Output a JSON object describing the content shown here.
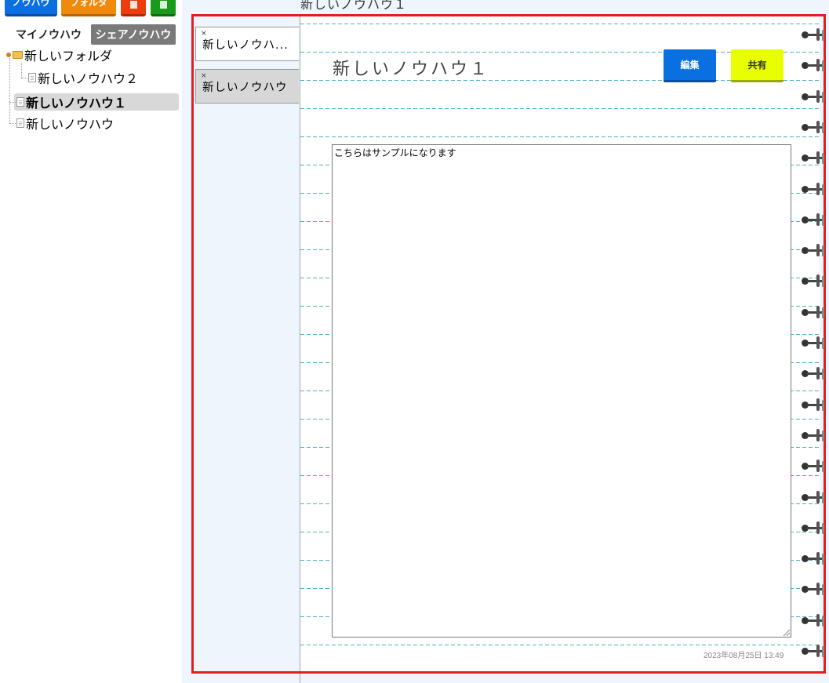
{
  "toolbar": {
    "knowhow_label": "ノウハウ",
    "folder_label": "フォルダ"
  },
  "sidebar": {
    "tabs": [
      {
        "label": "マイノウハウ"
      },
      {
        "label": "シェアノウハウ"
      }
    ],
    "tree": [
      {
        "label": "新しいフォルダ",
        "type": "folder"
      },
      {
        "label": "新しいノウハウ２",
        "type": "document"
      },
      {
        "label": "新しいノウハウ１",
        "type": "document",
        "selected": true
      },
      {
        "label": "新しいノウハウ",
        "type": "document"
      }
    ]
  },
  "header": {
    "title": "新しいノウハウ１"
  },
  "note_tabs": [
    {
      "label": "新しいノウハ...",
      "close": "×"
    },
    {
      "label": "新しいノウハウ",
      "close": "×"
    }
  ],
  "note": {
    "title": "新しいノウハウ１",
    "edit_label": "編集",
    "share_label": "共有",
    "body": "こちらはサンプルになります",
    "timestamp": "2023年08月25日 13:49"
  },
  "colors": {
    "knowhow_button": "#0a6fe0",
    "folder_button": "#f08a0c",
    "red_button": "#ee3d0d",
    "green_button": "#1a9a1a",
    "share_button": "#e8ff00",
    "frame_border": "#e02020",
    "rule_line": "#4fb0c6"
  }
}
